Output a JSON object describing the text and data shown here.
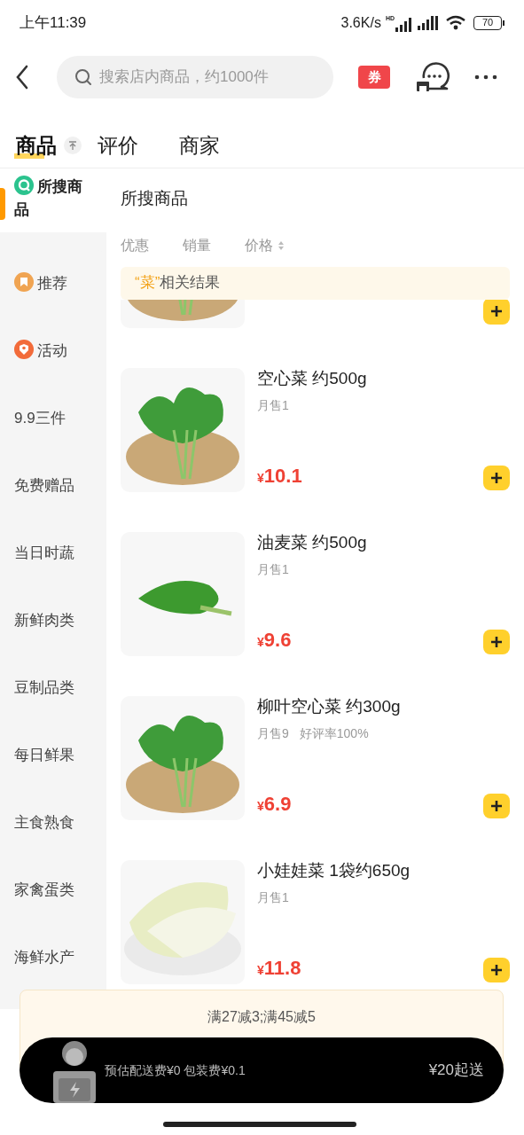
{
  "status_bar": {
    "time": "上午11:39",
    "speed": "3.6K/s",
    "network": "HD",
    "battery": "70"
  },
  "search": {
    "placeholder": "搜索店内商品，约1000件",
    "coupon": "券"
  },
  "tabs": [
    {
      "label": "商品",
      "selected": true
    },
    {
      "label": "评价",
      "selected": false
    },
    {
      "label": "商家",
      "selected": false
    }
  ],
  "sidebar": {
    "items": [
      {
        "label": "所搜商品",
        "kind": "icon",
        "selected": true
      },
      {
        "label": "推荐",
        "kind": "icon",
        "selected": false
      },
      {
        "label": "活动",
        "kind": "icon",
        "selected": false
      },
      {
        "label": "9.9三件",
        "selected": false
      },
      {
        "label": "免费赠品",
        "selected": false
      },
      {
        "label": "当日时蔬",
        "selected": false
      },
      {
        "label": "新鲜肉类",
        "selected": false
      },
      {
        "label": "豆制品类",
        "selected": false
      },
      {
        "label": "每日鲜果",
        "selected": false
      },
      {
        "label": "主食熟食",
        "selected": false
      },
      {
        "label": "家禽蛋类",
        "selected": false
      },
      {
        "label": "海鲜水产",
        "selected": false
      }
    ]
  },
  "section_title": "所搜商品",
  "sort_options": [
    {
      "label": "优惠",
      "kind": "plain"
    },
    {
      "label": "销量",
      "kind": "plain"
    },
    {
      "label": "价格",
      "kind": "toggle"
    }
  ],
  "result_banner": {
    "keyword": "“菜”",
    "text": "相关结果"
  },
  "products": [
    {
      "kind": "clipped"
    },
    {
      "kind": "full",
      "name": "空心菜 约500g",
      "sales": "月售1",
      "price": "10.1",
      "currency": "¥"
    },
    {
      "kind": "full",
      "name": "油麦菜 约500g",
      "sales": "月售1",
      "price": "9.6",
      "currency": "¥"
    },
    {
      "kind": "full",
      "name": "柳叶空心菜 约300g",
      "sales": "月售9",
      "rating": "好评率100%",
      "price": "6.9",
      "currency": "¥"
    },
    {
      "kind": "full",
      "name": "小娃娃菜 1袋约650g",
      "sales": "月售1",
      "price": "11.8",
      "currency": "¥"
    }
  ],
  "promo": "满27减3;满45减5",
  "cart": {
    "fee": "预估配送费¥0 包装费¥0.1",
    "minimum": "¥20起送"
  }
}
